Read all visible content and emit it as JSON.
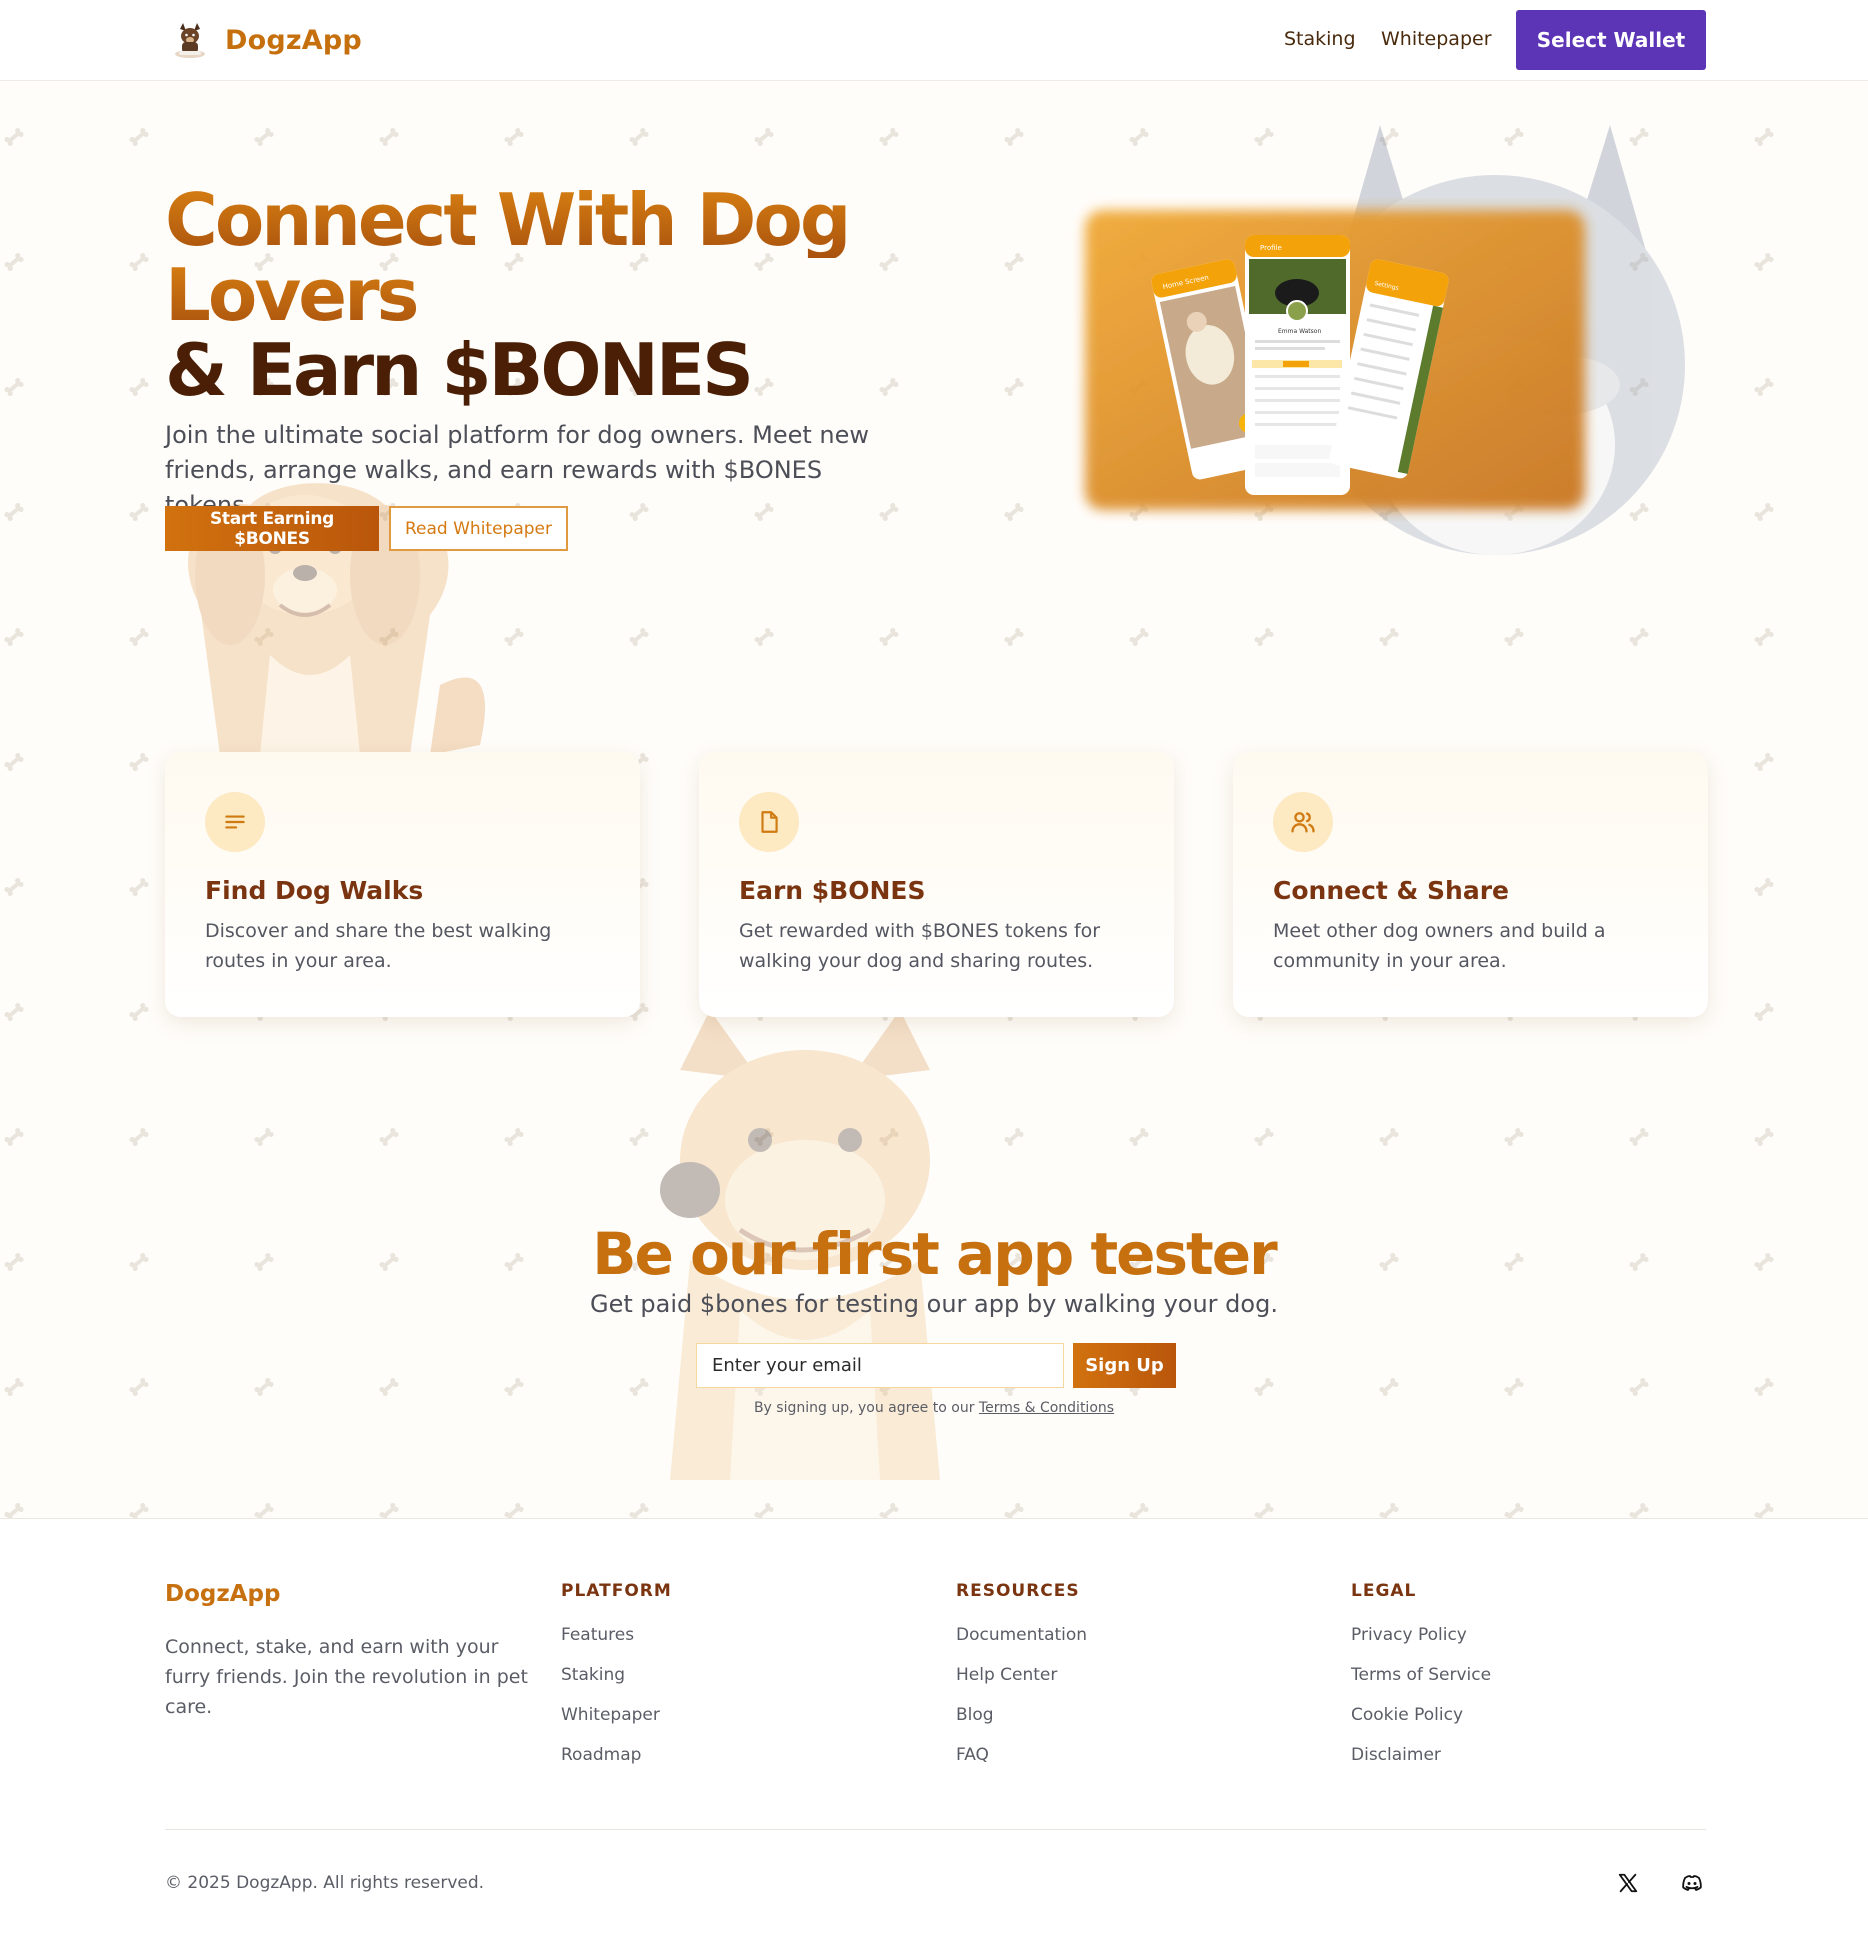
{
  "header": {
    "brand": "DogzApp",
    "nav": [
      {
        "label": "Staking"
      },
      {
        "label": "Whitepaper"
      }
    ],
    "wallet_button": "Select Wallet"
  },
  "hero": {
    "title_line1": "Connect With Dog",
    "title_line2": "Lovers",
    "title_line3": "& Earn $BONES",
    "subtitle": "Join the ultimate social platform for dog owners. Meet new friends, arrange walks, and earn rewards with $BONES tokens.",
    "primary_button": "Start Earning $BONES",
    "secondary_button": "Read Whitepaper",
    "phones": {
      "left_title": "Home Screen",
      "center_title": "Profile",
      "center_name": "Emma Watson",
      "right_title": "Settings"
    }
  },
  "features": [
    {
      "icon": "list-icon",
      "title": "Find Dog Walks",
      "text": "Discover and share the best walking routes in your area."
    },
    {
      "icon": "document-icon",
      "title": "Earn $BONES",
      "text": "Get rewarded with $BONES tokens for walking your dog and sharing routes."
    },
    {
      "icon": "users-icon",
      "title": "Connect & Share",
      "text": "Meet other dog owners and build a community in your area."
    }
  ],
  "tester": {
    "title": "Be our first app tester",
    "subtitle": "Get paid $bones for testing our app by walking your dog.",
    "email_placeholder": "Enter your email",
    "signup_button": "Sign Up",
    "terms_prefix": "By signing up, you agree to our ",
    "terms_link": "Terms & Conditions"
  },
  "footer": {
    "brand": "DogzApp",
    "description": "Connect, stake, and earn with your furry friends. Join the revolution in pet care.",
    "columns": [
      {
        "heading": "PLATFORM",
        "links": [
          "Features",
          "Staking",
          "Whitepaper",
          "Roadmap"
        ]
      },
      {
        "heading": "RESOURCES",
        "links": [
          "Documentation",
          "Help Center",
          "Blog",
          "FAQ"
        ]
      },
      {
        "heading": "LEGAL",
        "links": [
          "Privacy Policy",
          "Terms of Service",
          "Cookie Policy",
          "Disclaimer"
        ]
      }
    ],
    "copyright": "© 2025 DogzApp. All rights reserved.",
    "social": [
      {
        "icon": "x-icon"
      },
      {
        "icon": "discord-icon"
      }
    ]
  },
  "colors": {
    "accent": "#c6700f",
    "dark_brown": "#4a1f05",
    "wallet": "#5b35b6",
    "card_icon_bg": "#fde9c2"
  }
}
